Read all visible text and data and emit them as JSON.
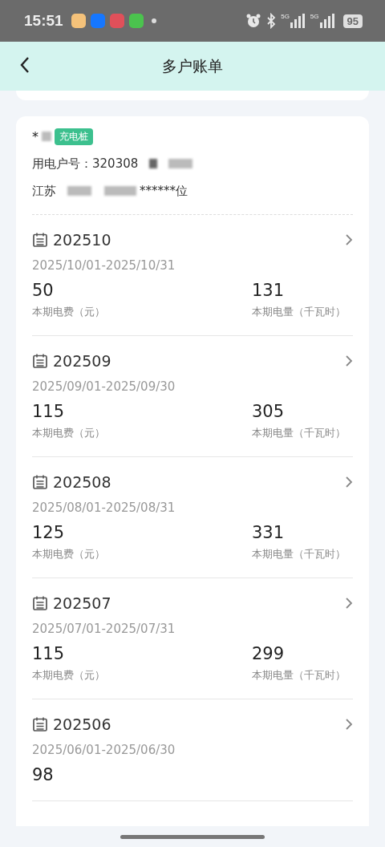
{
  "status_bar": {
    "time": "15:51",
    "network_labels": [
      "5G",
      "5G"
    ],
    "battery": "95"
  },
  "header": {
    "title": "多户账单"
  },
  "account": {
    "name": "*",
    "tag": "充电桩",
    "number": "用电户号：320308",
    "address_start": "江苏",
    "address_end": "******位"
  },
  "bills": [
    {
      "month": "202510",
      "range": "2025/10/01-2025/10/31",
      "fee": "50",
      "fee_label": "本期电费（元）",
      "usage": "131",
      "usage_label": "本期电量（千瓦时）"
    },
    {
      "month": "202509",
      "range": "2025/09/01-2025/09/30",
      "fee": "115",
      "fee_label": "本期电费（元）",
      "usage": "305",
      "usage_label": "本期电量（千瓦时）"
    },
    {
      "month": "202508",
      "range": "2025/08/01-2025/08/31",
      "fee": "125",
      "fee_label": "本期电费（元）",
      "usage": "331",
      "usage_label": "本期电量（千瓦时）"
    },
    {
      "month": "202507",
      "range": "2025/07/01-2025/07/31",
      "fee": "115",
      "fee_label": "本期电费（元）",
      "usage": "299",
      "usage_label": "本期电量（千瓦时）"
    },
    {
      "month": "202506",
      "range": "2025/06/01-2025/06/30",
      "fee": "98"
    }
  ]
}
